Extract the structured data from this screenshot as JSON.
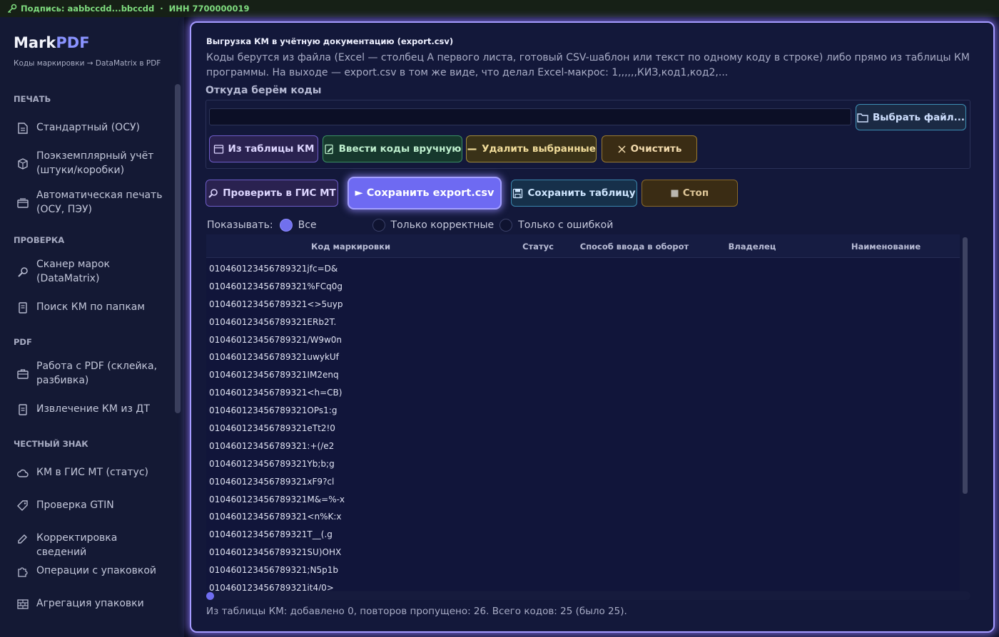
{
  "topbar": {
    "signature": "Подпись: aabbccdd...bbccdd",
    "separator": "·",
    "inn": "ИНН 7700000019"
  },
  "sidebar": {
    "logo_main": "Mark",
    "logo_accent": "PDF",
    "tagline": "Коды маркировки → DataMatrix в PDF",
    "sections": {
      "print": "ПЕЧАТЬ",
      "check": "ПРОВЕРКА",
      "pdf": "PDF",
      "honest": "ЧЕСТНЫЙ ЗНАК"
    },
    "items": [
      {
        "label": "Стандартный (ОСУ)",
        "icon": "label-icon"
      },
      {
        "label": "Поэкземплярный учёт (штуки/коробки)",
        "icon": "box-icon"
      },
      {
        "label": "Автоматическая печать (ОСУ, ПЭУ)",
        "icon": "printer-icon"
      },
      {
        "label": "Сканер марок (DataMatrix)",
        "icon": "scanner-icon"
      },
      {
        "label": "Поиск КМ по папкам",
        "icon": "document-icon"
      },
      {
        "label": "Работа с PDF (склейка, разбивка)",
        "icon": "briefcase-icon"
      },
      {
        "label": "Извлечение КМ из ДТ",
        "icon": "extract-icon"
      },
      {
        "label": "КМ в ГИС МТ (статус)",
        "icon": "cloud-icon"
      },
      {
        "label": "Проверка GTIN",
        "icon": "tag-icon"
      },
      {
        "label": "Корректировка сведений",
        "icon": "pencil-icon"
      },
      {
        "label": "Операции с упаковкой",
        "icon": "puzzle-icon"
      },
      {
        "label": "Агрегация упаковки",
        "icon": "bricks-icon"
      }
    ]
  },
  "main": {
    "title": "Выгрузка КМ в учётную документацию (export.csv)",
    "description": "Коды берутся из файла (Excel — столбец A первого листа, готовый CSV-шаблон или текст по одному коду в строке) либо прямо из таблицы КМ программы. На выходе — export.csv в том же виде, что делал Excel-макрос: 1,,,,,,КИЗ,код1,код2,...",
    "source_label": "Откуда берём коды",
    "path_value": "",
    "buttons": {
      "choose_file": "Выбрать файл...",
      "from_table": "Из таблицы КМ",
      "manual": "Ввести коды вручную",
      "delete_selected": "Удалить выбранные",
      "clear": "Очистить",
      "check_gis": "Проверить в ГИС МТ",
      "save_csv": "► Сохранить export.csv",
      "save_table": "Сохранить таблицу",
      "stop": "Стоп"
    },
    "filter": {
      "label": "Показывать:",
      "options": [
        "Все",
        "Только корректные",
        "Только с ошибкой"
      ],
      "selected": "Все"
    },
    "table": {
      "columns": [
        "Код маркировки",
        "Статус",
        "Способ ввода в оборот",
        "Владелец",
        "Наименование"
      ],
      "rows": [
        "010460123456789321jfc=D&",
        "010460123456789321%FCq0g",
        "010460123456789321<>5uyp",
        "010460123456789321ERb2T.",
        "010460123456789321/W9w0n",
        "010460123456789321uwykUf",
        "010460123456789321IM2enq",
        "010460123456789321<h=CB)",
        "010460123456789321OPs1:g",
        "010460123456789321eTt2!0",
        "010460123456789321:+(/e2",
        "010460123456789321Yb;b;g",
        "010460123456789321xF9?cl",
        "010460123456789321M&=%-x",
        "010460123456789321<n%K:x",
        "010460123456789321T__(.g",
        "010460123456789321SU)OHX",
        "010460123456789321;N5p1b",
        "010460123456789321jt4/0>"
      ]
    },
    "status": "Из таблицы КМ: добавлено 0, повторов пропущено: 26. Всего кодов: 25 (было 25)."
  },
  "colors": {
    "accent": "#6e6af2",
    "background": "#13183a",
    "sidebar": "#141934",
    "topbar_text": "#7fdc7f"
  }
}
